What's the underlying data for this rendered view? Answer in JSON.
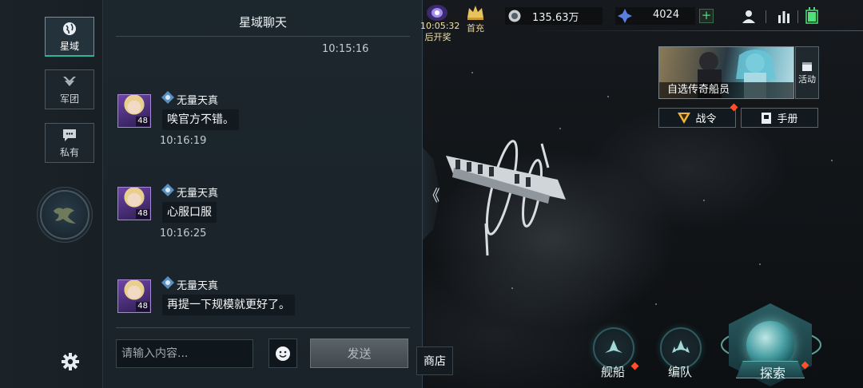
{
  "nav": {
    "tabs": [
      {
        "label": "星域",
        "icon": "globe-icon",
        "active": true
      },
      {
        "label": "军团",
        "icon": "legion-icon",
        "active": false
      },
      {
        "label": "私有",
        "icon": "chat-bubble-icon",
        "active": false
      }
    ],
    "settings_icon": "gear-icon"
  },
  "chat": {
    "title": "星域聊天",
    "top_time": "10:15:16",
    "messages": [
      {
        "sender": "无量天真",
        "level": "48",
        "text": "唉官方不错。",
        "time": "10:16:19"
      },
      {
        "sender": "无量天真",
        "level": "48",
        "text": "心服口服",
        "time": "10:16:25"
      },
      {
        "sender": "无量天真",
        "level": "48",
        "text": "再提一下规模就更好了。",
        "time": ""
      }
    ],
    "input_placeholder": "请输入内容...",
    "send_label": "发送",
    "collapse_glyph": "《"
  },
  "hud": {
    "timer": "10:05:32",
    "timer_label": "后开奖",
    "first_recharge": "首充",
    "currency_amount": "135.63万",
    "energy_amount": "4024",
    "plus_label": "+"
  },
  "right_panel": {
    "promo_label": "自选传奇船员",
    "activity_label": "活动",
    "battle_pass_label": "战令",
    "manual_label": "手册"
  },
  "bottom": {
    "shop_label": "商店",
    "ships_label": "舰船",
    "fleet_label": "编队",
    "explore_label": "探索"
  },
  "colors": {
    "accent_teal": "#2fb39a",
    "alert_red": "#ff4f2b",
    "gold": "#f1d37c"
  }
}
